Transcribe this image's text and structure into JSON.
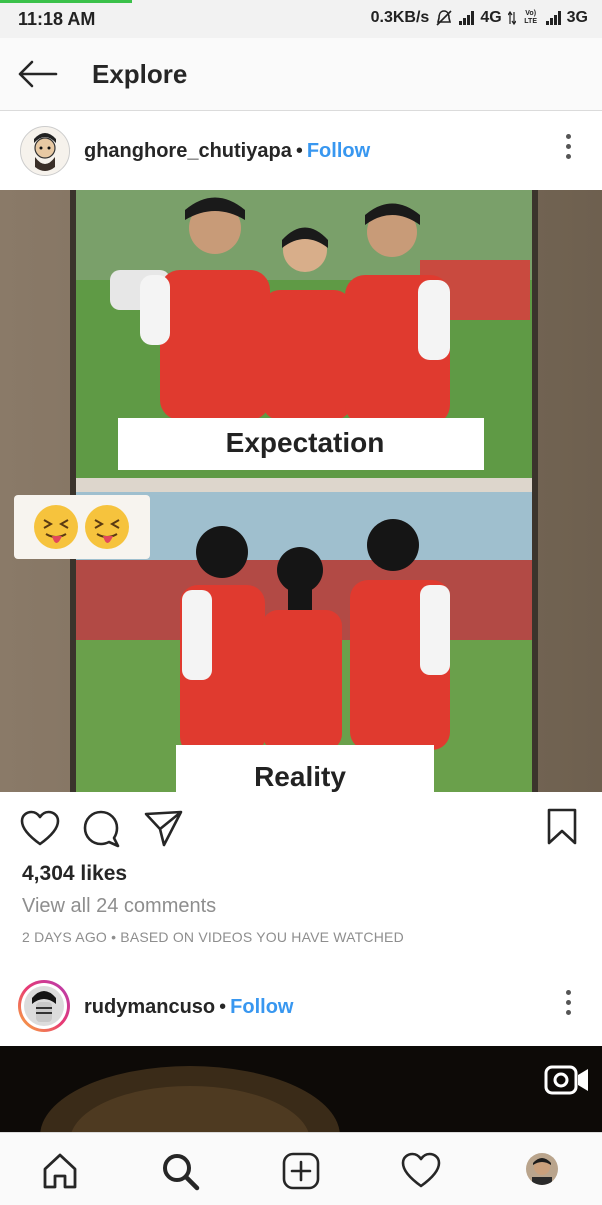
{
  "status_bar": {
    "time": "11:18 AM",
    "net_speed": "0.3KB/s",
    "net1": "4G",
    "volte": "Vo) LTE",
    "net2": "3G"
  },
  "header": {
    "title": "Explore"
  },
  "post1": {
    "username": "ghanghore_chutiyapa",
    "separator": "•",
    "follow_label": "Follow",
    "image": {
      "caption_top": "Expectation",
      "caption_bottom": "Reality"
    },
    "likes": "4,304 likes",
    "view_comments": "View all 24 comments",
    "meta": "2 DAYS AGO • BASED ON VIDEOS YOU HAVE WATCHED"
  },
  "post2": {
    "username": "rudymancuso",
    "separator": "•",
    "follow_label": "Follow"
  },
  "icons": {
    "back": "back-arrow-icon",
    "like": "heart-icon",
    "comment": "comment-icon",
    "share": "share-icon",
    "save": "bookmark-icon",
    "more": "more-vertical-icon",
    "video": "video-camera-icon",
    "nav": [
      "home-icon",
      "search-icon",
      "add-icon",
      "activity-heart-icon",
      "profile-avatar"
    ]
  },
  "colors": {
    "follow": "#3897f0",
    "progress": "#3bc14a",
    "shirt": "#e03a2f"
  }
}
